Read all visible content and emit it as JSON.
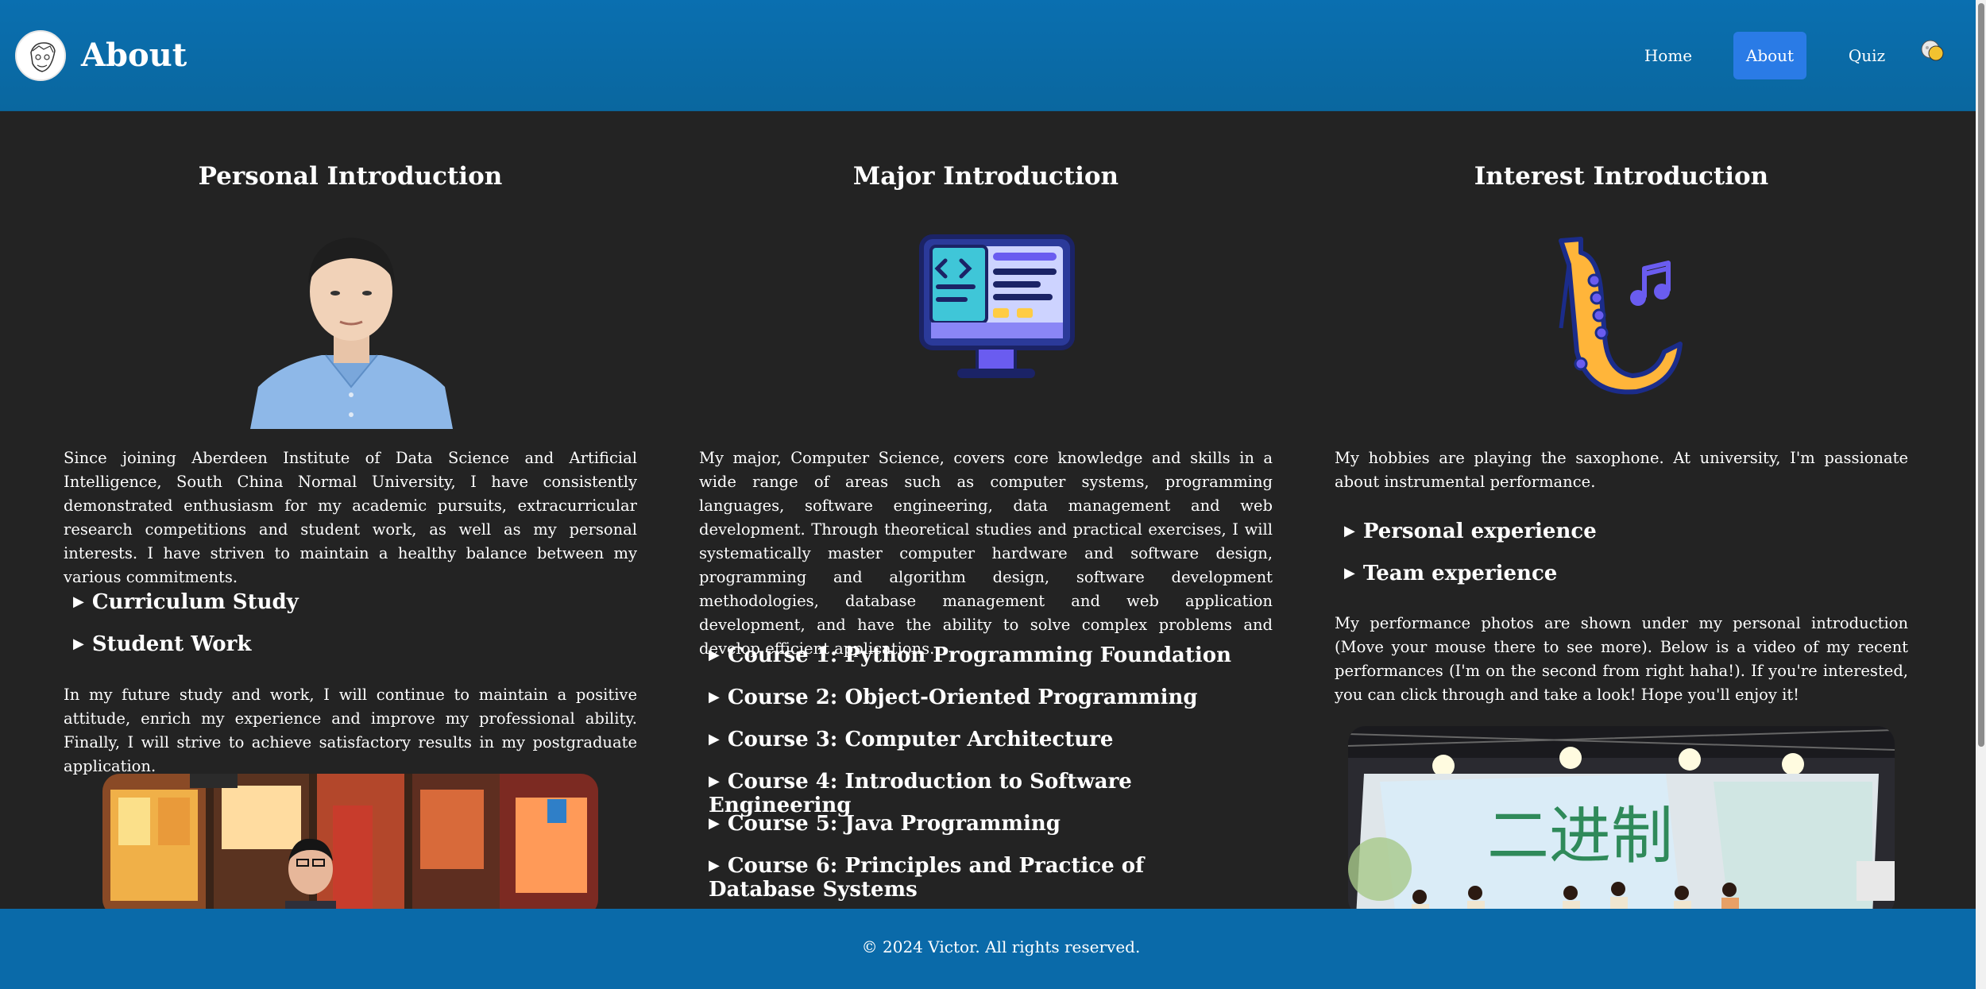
{
  "header": {
    "title": "About",
    "nav": [
      {
        "label": "Home"
      },
      {
        "label": "About"
      },
      {
        "label": "Quiz"
      }
    ]
  },
  "personal": {
    "title": "Personal Introduction",
    "para1": "Since joining Aberdeen Institute of Data Science and Artificial Intelligence, South China Normal University, I have consistently demonstrated enthusiasm for my academic pursuits, extracurricular research competitions and student work, as well as my personal interests. I have striven to maintain a healthy balance between my various commitments.",
    "summaries": [
      "Curriculum Study",
      "Student Work"
    ],
    "para2": "In my future study and work, I will continue to maintain a positive attitude, enrich my experience and improve my professional ability. Finally, I will strive to achieve satisfactory results in my postgraduate application."
  },
  "major": {
    "title": "Major Introduction",
    "para1": "My major, Computer Science, covers core knowledge and skills in a wide range of areas such as computer systems, programming languages, software engineering, data management and web development. Through theoretical studies and practical exercises, I will systematically master computer hardware and software design, programming and algorithm design, software development methodologies, database management and web application development, and have the ability to solve complex problems and develop efficient applications.",
    "courses": [
      "Course 1: Python Programming Foundation",
      "Course 2: Object-Oriented Programming",
      "Course 3: Computer Architecture",
      "Course 4: Introduction to Software Engineering",
      "Course 5: Java Programming",
      "Course 6: Principles and Practice of Database Systems"
    ]
  },
  "interest": {
    "title": "Interest Introduction",
    "para1": "My hobbies are playing the saxophone. At university, I'm passionate about instrumental performance.",
    "summaries": [
      "Personal experience",
      "Team experience"
    ],
    "para2": "My performance photos are shown under my personal introduction (Move your mouse there to see more). Below is a video of my recent performances (I'm on the second from right haha!). If you're interested, you can click through and take a look! Hope you'll enjoy it!",
    "banner_text": "二进制"
  },
  "footer": {
    "text": "© 2024 Victor. All rights reserved."
  },
  "colors": {
    "header": "#0a6fb0",
    "active_nav": "#2a7be6",
    "body_bg": "#232323"
  }
}
